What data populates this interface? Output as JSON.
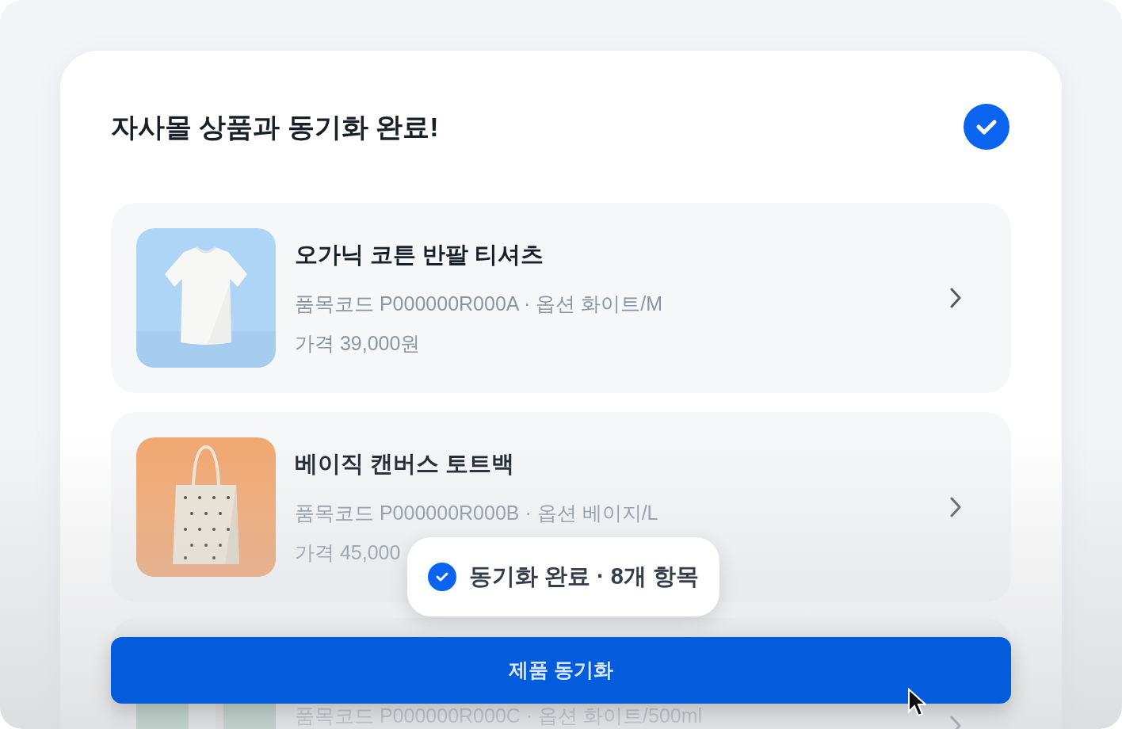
{
  "title": "자사몰 상품과 동기화 완료!",
  "products": [
    {
      "name": "오가닉 코튼 반팔 티셔츠",
      "meta": "품목코드 P000000R000A · 옵션 화이트/M",
      "price": "가격 39,000원"
    },
    {
      "name": "베이직 캔버스 토트백",
      "meta": "품목코드 P000000R000B · 옵션 베이지/L",
      "price": "가격 45,000"
    },
    {
      "meta": "품목코드 P000000R000C · 옵션 화이트/500ml"
    }
  ],
  "toast": {
    "text": "동기화 완료 · 8개 항목"
  },
  "button": {
    "label": "제품 동기화"
  }
}
